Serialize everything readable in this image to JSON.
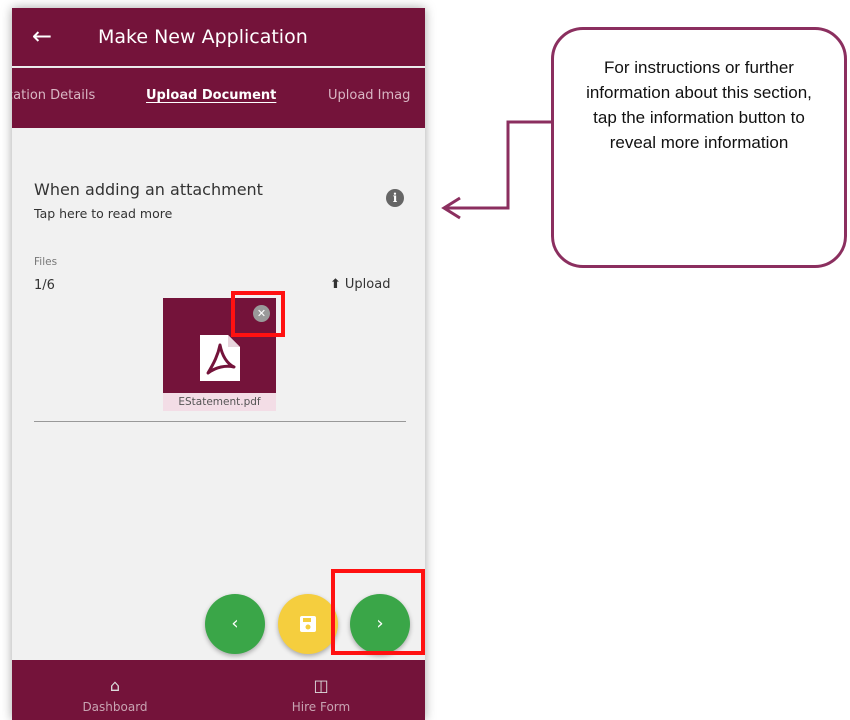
{
  "header": {
    "back_icon": "arrow-left-icon",
    "title": "Make New Application"
  },
  "tabs": [
    {
      "label": "cation Details",
      "active": false
    },
    {
      "label": "Upload Document",
      "active": true
    },
    {
      "label": "Upload Imag",
      "active": false
    }
  ],
  "info": {
    "heading": "When adding an attachment",
    "subtext": "Tap here to read more",
    "icon": "info-icon",
    "icon_glyph": "i"
  },
  "files": {
    "label": "Files",
    "count": "1/6",
    "upload_label": "Upload",
    "upload_icon": "upload-icon",
    "items": [
      {
        "name": "EStatement.pdf",
        "icon": "pdf-file-icon"
      }
    ]
  },
  "actions": {
    "prev_glyph": "‹",
    "save_icon": "save-icon",
    "next_glyph": "›"
  },
  "bottom_nav": [
    {
      "label": "Dashboard",
      "icon": "home-icon"
    },
    {
      "label": "Hire Form",
      "icon": "form-icon"
    }
  ],
  "callout": {
    "text": "For instructions or further information about this section, tap the information button to reveal more information"
  },
  "colors": {
    "brand": "#74133a",
    "fab_green": "#3aa648",
    "fab_yellow": "#f5ce3e",
    "highlight_red": "#ff1111",
    "callout_border": "#8b2f5f"
  }
}
